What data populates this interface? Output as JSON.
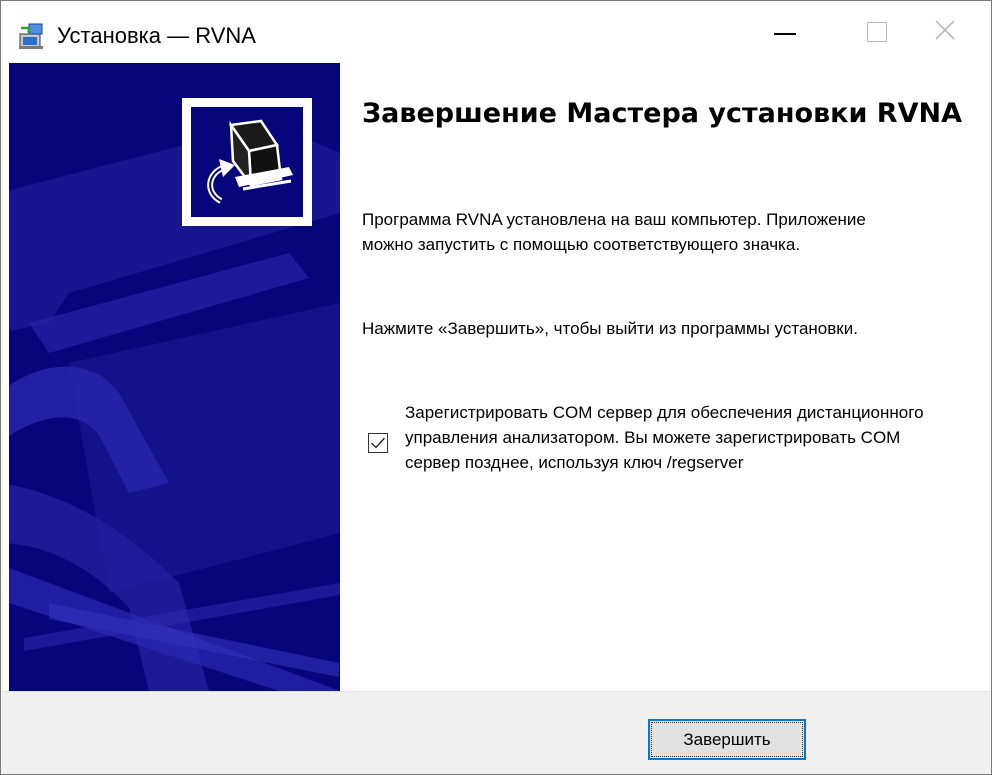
{
  "window": {
    "title": "Установка — RVNA",
    "icons": [
      "setup-app-icon",
      "minimize-icon",
      "maximize-icon",
      "close-icon"
    ]
  },
  "banner": {
    "logo_icon": "computer-install-icon"
  },
  "content": {
    "heading": "Завершение Мастера установки RVNA",
    "paragraph1": "Программа RVNA установлена на ваш компьютер. Приложение можно запустить с помощью соответствующего значка.",
    "paragraph2": "Нажмите «Завершить», чтобы выйти из программы установки.",
    "register_com": {
      "checked": true,
      "label": "Зарегистрировать COM сервер для обеспечения дистанционного управления анализатором. Вы можете зарегистрировать COM сервер позднее, используя ключ /regserver"
    }
  },
  "footer": {
    "finish_label": "Завершить"
  },
  "colors": {
    "banner": "#06067c",
    "banner_art": "#1c1c9c",
    "focus_border": "#0078d7",
    "footer_bg": "#f0f0f0"
  }
}
